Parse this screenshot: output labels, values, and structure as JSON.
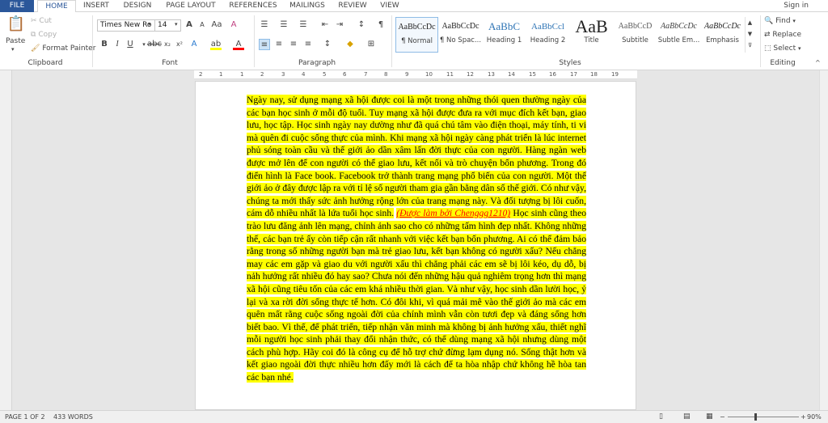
{
  "tabs": [
    "FILE",
    "HOME",
    "INSERT",
    "DESIGN",
    "PAGE LAYOUT",
    "REFERENCES",
    "MAILINGS",
    "REVIEW",
    "VIEW"
  ],
  "signin": "Sign in",
  "clipboard": {
    "paste": "Paste",
    "cut": "Cut",
    "copy": "Copy",
    "format_painter": "Format Painter",
    "label": "Clipboard"
  },
  "font": {
    "name": "Times New Ro",
    "size": "14",
    "label": "Font"
  },
  "paragraph": {
    "label": "Paragraph"
  },
  "styles": {
    "items": [
      {
        "preview": "AaBbCcDc",
        "name": "¶ Normal"
      },
      {
        "preview": "AaBbCcDc",
        "name": "¶ No Spac..."
      },
      {
        "preview": "AaBbC",
        "name": "Heading 1"
      },
      {
        "preview": "AaBbCcl",
        "name": "Heading 2"
      },
      {
        "preview": "AaB",
        "name": "Title"
      },
      {
        "preview": "AaBbCcD",
        "name": "Subtitle"
      },
      {
        "preview": "AaBbCcDc",
        "name": "Subtle Em..."
      },
      {
        "preview": "AaBbCcDc",
        "name": "Emphasis"
      }
    ],
    "label": "Styles"
  },
  "editing": {
    "find": "Find",
    "replace": "Replace",
    "select": "Select",
    "label": "Editing"
  },
  "ruler_numbers": [
    "2",
    "1",
    "1",
    "2",
    "3",
    "4",
    "5",
    "6",
    "7",
    "8",
    "9",
    "10",
    "11",
    "12",
    "13",
    "14",
    "15",
    "16",
    "17",
    "18",
    "19"
  ],
  "document": {
    "text_before": "Ngày nay, sử dụng mạng xã hội được coi là một trong những thói quen thường ngày của các bạn học sinh ở mỗi độ tuổi. Tuy mạng xã hội được đưa ra với mục đích kết bạn, giao lưu, học tập. Học sinh ngày nay dường như đã quá chú tâm vào điện thoại, máy tính, ti vi mà quên đi cuộc sống thực của mình. Khi mạng xã hội ngày càng phát triển là lúc internet phủ sóng toàn cầu và thế giới ảo dần xâm lấn đời thực của con người. Hàng ngàn web được mở lên để con người có thể giao lưu, kết nối và trò chuyện bốn phương. Trong đó điển hình là Face book. Facebook trở thành trang mạng phổ biến của con người. Một thế giới ảo ở đây được lập ra với tỉ lệ số người tham gia gần bằng dân số thế giới. Có như vậy, chúng ta mới thấy sức ảnh hưởng rộng lớn của trang mạng này. Và đối tượng bị lôi cuốn, cám dỗ nhiều nhất là lứa tuổi học sinh.",
    "link": "(Được làm bởi Chenggg1210)",
    "text_after": " Học sinh cũng theo trào lưu đăng ảnh lên mạng, chỉnh ảnh sao cho có những tấm hình đẹp nhất. Không những thế, các bạn trẻ ấy còn tiếp cận rất nhanh với việc kết bạn bốn phương. Ai có thể đảm bảo rằng trong số những người bạn mà trẻ giao lưu, kết bạn không có người xấu? Nếu chẳng may các em gặp và giao du với người xấu thì chẳng phải các em sẽ bị lôi kéo, dụ dỗ, bị nảh hưởng rất nhiều đó hay sao? Chưa nói đến những hậu quả nghiêm trọng hơn thì mạng xã hội cũng tiêu tốn của các em khá nhiều thời gian. Và như vậy, học sinh dần lười học, ỷ lại và xa rời đời sống thực tế hơn. Có đôi khi, vì quá mải mê vào thế giới ảo mà các em quên mất rằng cuộc sống ngoài đời của chính mình vẫn còn tươi đẹp và đáng sống hơn biết bao. Vì thế, để phát triển, tiếp nhận văn minh mà không bị ảnh hưởng xấu, thiết nghĩ mỗi người học sinh phải thay đổi nhận thức, có thể dùng mạng xã hội nhưng dùng một cách phù hợp. Hãy coi đó là công cụ để hỗ trợ chứ đừng lạm dụng nó. Sống thật hơn và kết giao ngoài đời thực nhiều hơn đấy mới là cách để ta hòa nhập chứ không hề hòa tan các bạn nhé."
  },
  "status": {
    "page": "PAGE 1 OF 2",
    "words": "433 WORDS",
    "zoom": "90%"
  },
  "colors": {
    "accent": "#2b579a",
    "highlight": "#ffff00",
    "link": "#ff0000"
  }
}
